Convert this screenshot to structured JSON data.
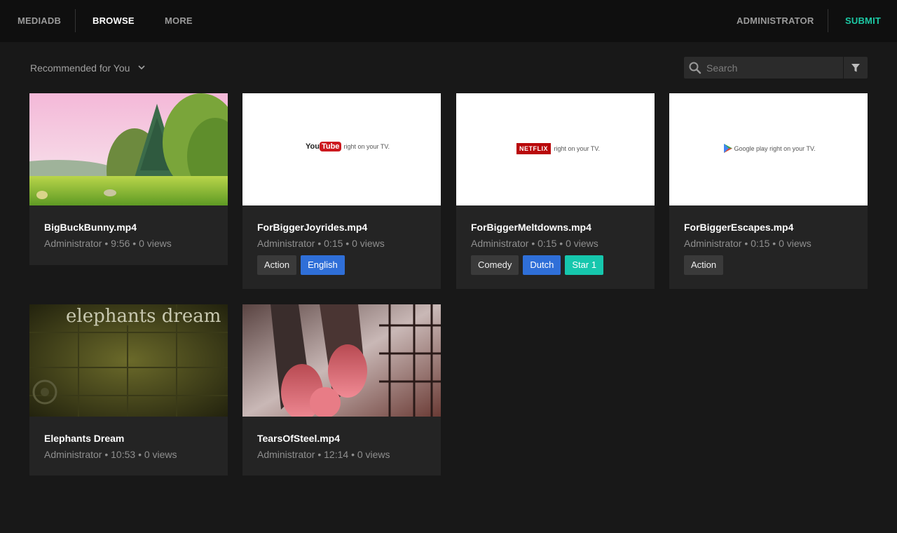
{
  "nav": {
    "brand": "MEDIADB",
    "browse": "BROWSE",
    "more": "MORE",
    "user": "ADMINISTRATOR",
    "submit": "SUBMIT"
  },
  "toolbar": {
    "sort_label": "Recommended for You",
    "search_placeholder": "Search",
    "search_value": ""
  },
  "colors": {
    "accent": "#1cc9a5",
    "tag_blue": "#2f6fd8",
    "tag_teal": "#16c7ad",
    "tag_gray": "#3a3a3a"
  },
  "videos": [
    {
      "title": "BigBuckBunny.mp4",
      "meta": "Administrator • 9:56 • 0 views",
      "tags": []
    },
    {
      "title": "ForBiggerJoyrides.mp4",
      "meta": "Administrator • 0:15 • 0 views",
      "tags": [
        {
          "label": "Action",
          "color": "gray"
        },
        {
          "label": "English",
          "color": "blue"
        }
      ],
      "thumb_text": {
        "brand": "You",
        "brand2": "Tube",
        "tagline": "right on your TV."
      }
    },
    {
      "title": "ForBiggerMeltdowns.mp4",
      "meta": "Administrator • 0:15 • 0 views",
      "tags": [
        {
          "label": "Comedy",
          "color": "gray"
        },
        {
          "label": "Dutch",
          "color": "blue"
        },
        {
          "label": "Star 1",
          "color": "teal"
        }
      ],
      "thumb_text": {
        "brand": "NETFLIX",
        "tagline": "right on your TV."
      }
    },
    {
      "title": "ForBiggerEscapes.mp4",
      "meta": "Administrator • 0:15 • 0 views",
      "tags": [
        {
          "label": "Action",
          "color": "gray"
        }
      ],
      "thumb_text": {
        "brand": "Google play",
        "tagline": "right on your TV."
      }
    },
    {
      "title": "Elephants Dream",
      "meta": "Administrator • 10:53 • 0 views",
      "tags": [],
      "thumb_text": {
        "title": "elephants dream"
      }
    },
    {
      "title": "TearsOfSteel.mp4",
      "meta": "Administrator • 12:14 • 0 views",
      "tags": []
    }
  ]
}
